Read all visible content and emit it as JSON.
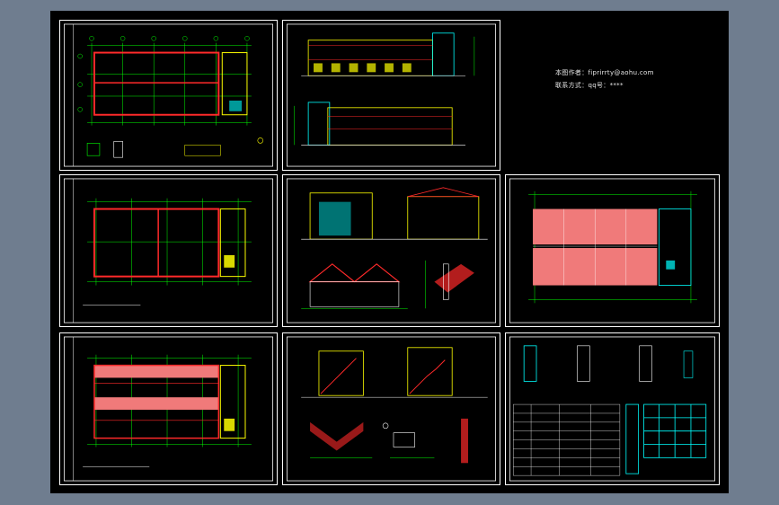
{
  "credits": {
    "author_line": "本图作者：fiprirrty@aohu.com",
    "contact_line": "联系方式：qq号：****"
  },
  "colors": {
    "background": "#6f7d8f",
    "canvas": "#000000",
    "frame": "#ffffff",
    "grid": "#00ff00",
    "wall": "#ff2a2a",
    "accent_yellow": "#ffff00",
    "accent_cyan": "#00ffff",
    "fill_pink": "#f07a7a"
  },
  "sheets": [
    {
      "id": "sheet-ground-floor-plan"
    },
    {
      "id": "sheet-front-rear-elevations"
    },
    {
      "id": "sheet-second-floor-plan"
    },
    {
      "id": "sheet-side-elevations-sections"
    },
    {
      "id": "sheet-roof-plan"
    },
    {
      "id": "sheet-third-floor-plan"
    },
    {
      "id": "sheet-stair-sections"
    },
    {
      "id": "sheet-details-door-window-schedule"
    }
  ]
}
